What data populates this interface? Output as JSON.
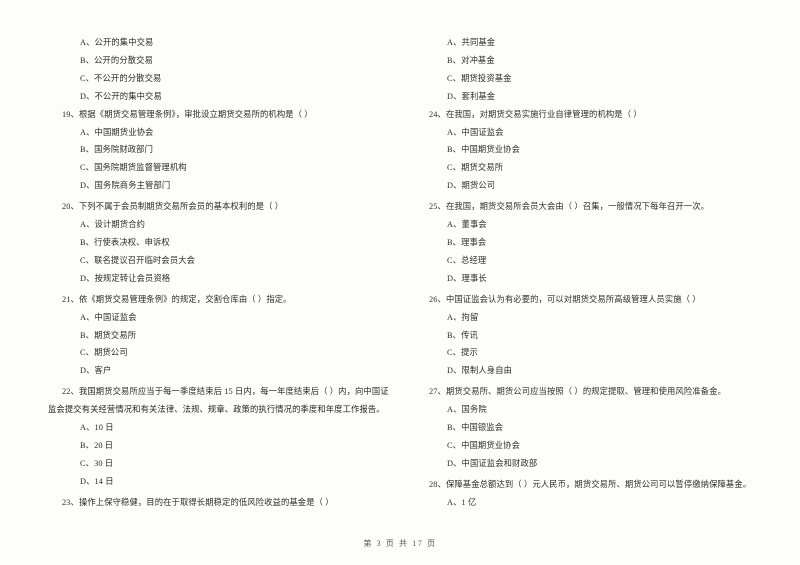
{
  "document": {
    "kind": "scanned-exam-paper",
    "footer": "第 3 页 共 17 页"
  },
  "columns": {
    "left": {
      "orphan_options": [
        "A、公开的集中交易",
        "B、公开的分散交易",
        "C、不公开的分散交易",
        "D、不公开的集中交易"
      ],
      "questions": [
        {
          "number": "19、",
          "stem": "根据《期货交易管理条例》，审批设立期货交易所的机构是（        ）",
          "options": [
            "A、中国期货业协会",
            "B、国务院财政部门",
            "C、国务院期货监督管理机构",
            "D、国务院商务主管部门"
          ]
        },
        {
          "number": "20、",
          "stem": "下列不属于会员制期货交易所会员的基本权利的是（        ）",
          "options": [
            "A、设计期货合约",
            "B、行使表决权、申诉权",
            "C、联名提议召开临时会员大会",
            "D、按规定转让会员资格"
          ]
        },
        {
          "number": "21、",
          "stem": "依《期货交易管理条例》的规定，交割仓库由（        ）指定。",
          "options": [
            "A、中国证监会",
            "B、期货交易所",
            "C、期货公司",
            "D、客户"
          ]
        },
        {
          "number": "22、",
          "stem": "我国期货交易所应当于每一季度结束后 15 日内，每一年度结束后（        ）内，向中国证",
          "stem_cont": "监会提交有关经营情况和有关法律、法规、规章、政策的执行情况的季度和年度工作报告。",
          "options": [
            "A、10 日",
            "B、20 日",
            "C、30 日",
            "D、14 日"
          ]
        },
        {
          "number": "23、",
          "stem": "操作上保守稳健，目的在于取得长期稳定的低风险收益的基金是（        ）",
          "options": []
        }
      ]
    },
    "right": {
      "orphan_options": [
        "A、共同基金",
        "B、对冲基金",
        "C、期货投资基金",
        "D、套利基金"
      ],
      "questions": [
        {
          "number": "24、",
          "stem": "在我国，对期货交易实施行业自律管理的机构是（        ）",
          "options": [
            "A、中国证监会",
            "B、中国期货业协会",
            "C、期货交易所",
            "D、期货公司"
          ]
        },
        {
          "number": "25、",
          "stem": "在我国，期货交易所会员大会由（        ）召集，一般情况下每年召开一次。",
          "options": [
            "A、董事会",
            "B、理事会",
            "C、总经理",
            "D、理事长"
          ]
        },
        {
          "number": "26、",
          "stem": "中国证监会认为有必要的，可以对期货交易所高级管理人员实施（        ）",
          "options": [
            "A、拘留",
            "B、传讯",
            "C、提示",
            "D、限制人身自由"
          ]
        },
        {
          "number": "27、",
          "stem": "期货交易所、期货公司应当按照（        ）的规定提取、管理和使用风险准备金。",
          "options": [
            "A、国务院",
            "B、中国银监会",
            "C、中国期货业协会",
            "D、中国证监会和财政部"
          ]
        },
        {
          "number": "28、",
          "stem": "保障基金总额达到（        ）元人民币，期货交易所、期货公司可以暂停缴纳保障基金。",
          "options": [
            "A、1 亿"
          ]
        }
      ]
    }
  }
}
